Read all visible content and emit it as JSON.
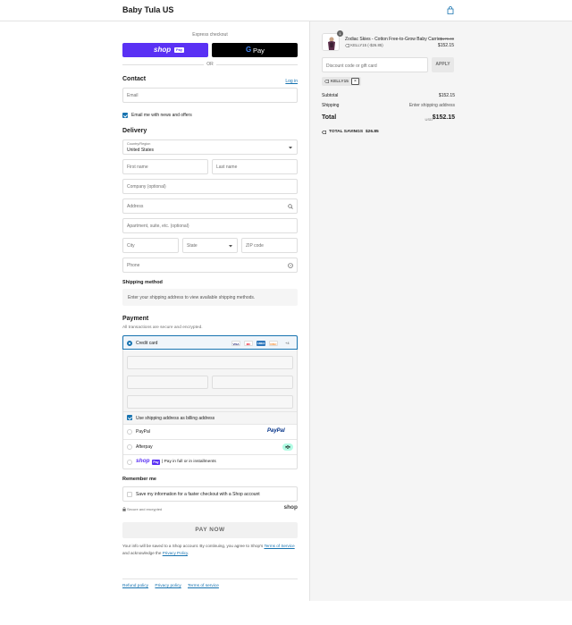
{
  "header": {
    "brand": "Baby Tula US",
    "cart_icon": "shopping-bag-icon"
  },
  "express": {
    "label": "Express checkout",
    "shop_pay_label": "shop",
    "shop_pay_badge": "Pay",
    "gpay_label": "Pay",
    "or_label": "OR"
  },
  "contact": {
    "title": "Contact",
    "login_link": "Log in",
    "email_placeholder": "Email",
    "newsletter_label": "Email me with news and offers"
  },
  "delivery": {
    "title": "Delivery",
    "country_label": "Country/Region",
    "country_value": "United States",
    "first_name": "First name",
    "last_name": "Last name",
    "company": "Company (optional)",
    "address": "Address",
    "apartment": "Apartment, suite, etc. (optional)",
    "city": "City",
    "state": "State",
    "zip": "ZIP code",
    "phone": "Phone"
  },
  "shipping_method": {
    "title": "Shipping method",
    "info": "Enter your shipping address to view available shipping methods."
  },
  "payment": {
    "title": "Payment",
    "subtitle": "All transactions are secure and encrypted.",
    "credit_card_label": "Credit card",
    "card_logos": [
      "VISA",
      "MC",
      "AMEX",
      "DISC"
    ],
    "more_cards": "+4",
    "billing_same_label": "Use shipping address as billing address",
    "paypal_label": "PayPal",
    "paypal_logo": "PayPal",
    "afterpay_label": "Afterpay",
    "shoppay_label": "shop",
    "shoppay_badge": "Pay",
    "shoppay_installments": "Pay in full or in installments"
  },
  "remember": {
    "title": "Remember me",
    "save_label": "Save my information for a faster checkout with a Shop account",
    "secure_label": "Secure and encrypted",
    "shop_logo": "shop"
  },
  "pay_now_label": "PAY NOW",
  "fine_print": {
    "text": "Your info will be saved to a Shop account. By continuing, you agree to Shop's ",
    "terms_link": "Terms of Service",
    "and_text": " and acknowledge the ",
    "privacy_link": "Privacy Policy",
    "end": "."
  },
  "footer": {
    "links": [
      "Refund policy",
      "Privacy policy",
      "Terms of service"
    ]
  },
  "order": {
    "product_name": "Zodiac Skies - Cotton Free-to-Grow Baby Carrier",
    "quantity": "1",
    "discount_code_line": "KELLY15 (-$26.85)",
    "old_price": "$179.00",
    "price": "$152.15",
    "discount_placeholder": "Discount code or gift card",
    "apply_label": "APPLY",
    "applied_tag": "KELLY15",
    "subtotal_label": "Subtotal",
    "subtotal_value": "$152.15",
    "shipping_label": "Shipping",
    "shipping_value": "Enter shipping address",
    "total_label": "Total",
    "currency": "USD",
    "total_value": "$152.15",
    "savings_label": "TOTAL SAVINGS",
    "savings_value": "$26.85"
  },
  "colors": {
    "accent": "#1773b0",
    "shop_pay": "#5a31f4",
    "afterpay": "#b2fce4"
  }
}
